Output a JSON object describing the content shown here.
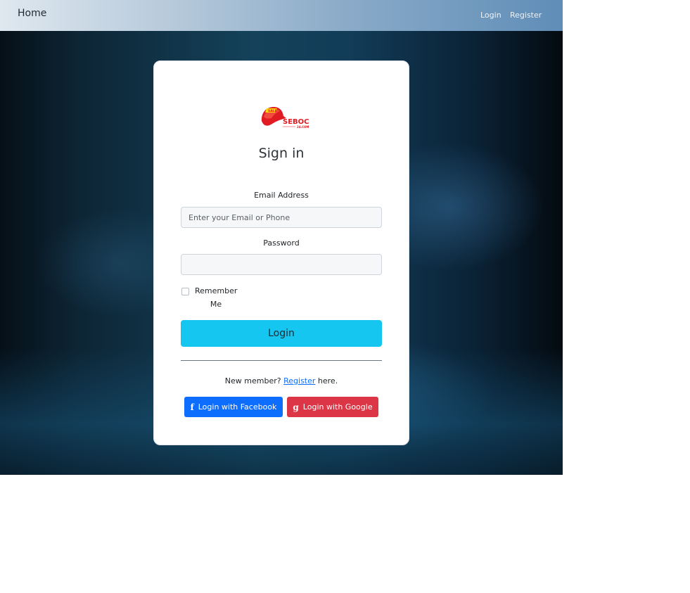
{
  "navbar": {
    "brand": "Home",
    "links": [
      "Login",
      "Register"
    ]
  },
  "logo": {
    "text": "SEBOC",
    "subtext": "24.COM"
  },
  "form": {
    "title": "Sign in",
    "email": {
      "label": "Email Address",
      "placeholder": "Enter your Email or Phone",
      "value": ""
    },
    "password": {
      "label": "Password",
      "value": ""
    },
    "remember": {
      "line1": "Remember",
      "line2": "Me",
      "checked": false
    },
    "submit_label": "Login",
    "register_prefix": "New member?",
    "register_link": "Register",
    "register_suffix": "here.",
    "facebook": {
      "icon": "facebook-icon",
      "label": "Login with Facebook"
    },
    "google": {
      "icon": "google-icon",
      "label": "Login with Google"
    }
  },
  "colors": {
    "primary": "#0d6efd",
    "danger": "#dc3545",
    "info": "#14c6f0"
  }
}
